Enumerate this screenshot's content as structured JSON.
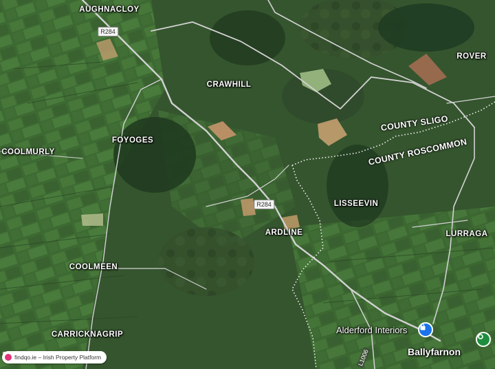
{
  "map": {
    "towns": [
      {
        "id": "aughnacloy",
        "label": "AUGHNACLOY"
      },
      {
        "id": "crawhill",
        "label": "CRAWHILL"
      },
      {
        "id": "rover",
        "label": "ROVER"
      },
      {
        "id": "foyoges",
        "label": "FOYOGES"
      },
      {
        "id": "coolmurly",
        "label": "COOLMURLY"
      },
      {
        "id": "lisseevin",
        "label": "LISSEEVIN"
      },
      {
        "id": "ardline",
        "label": "ARDLINE"
      },
      {
        "id": "lurraga",
        "label": "LURRAGA"
      },
      {
        "id": "coolmeen",
        "label": "COOLMEEN"
      },
      {
        "id": "carricknagrip",
        "label": "CARRICKNAGRIP"
      }
    ],
    "roads": {
      "r284_top": "R284",
      "r284_mid": "R284",
      "l1006": "L1006"
    },
    "counties": {
      "north": "COUNTY SLIGO",
      "south": "COUNTY ROSCOMMON"
    },
    "poi": {
      "alderford": "Alderford Interiors"
    },
    "village": {
      "ballyfarnon": "Ballyfarnon"
    },
    "colors": {
      "road": "#d2d2d2",
      "boundary": "#ffffff",
      "poi_pin": "#1a73e8",
      "green_pin": "#1e8e3e"
    }
  },
  "attribution": {
    "text": "findqo.ie – Irish Property Platform"
  }
}
